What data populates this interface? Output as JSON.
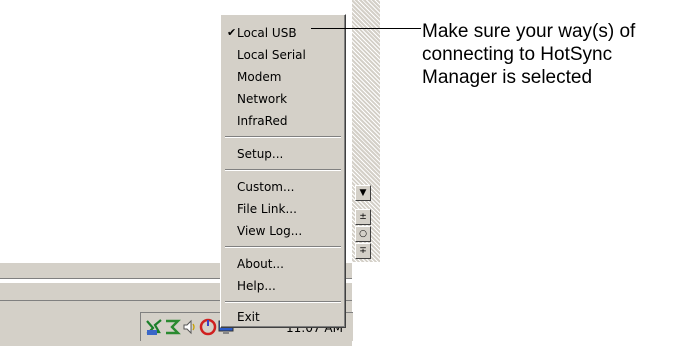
{
  "menu": {
    "items": [
      {
        "label": "Local USB",
        "checked": true
      },
      {
        "label": "Local Serial",
        "checked": false
      },
      {
        "label": "Modem",
        "checked": false
      },
      {
        "label": "Network",
        "checked": false
      },
      {
        "label": "InfraRed",
        "checked": false
      },
      {
        "label": "Setup...",
        "checked": false
      },
      {
        "label": "Custom...",
        "checked": false
      },
      {
        "label": "File Link...",
        "checked": false
      },
      {
        "label": "View Log...",
        "checked": false
      },
      {
        "label": "About...",
        "checked": false
      },
      {
        "label": "Help...",
        "checked": false
      },
      {
        "label": "Exit",
        "checked": false
      }
    ],
    "check_glyph": "✔"
  },
  "callout": {
    "lines": [
      "Make sure your way(s) of",
      "connecting to HotSync",
      "Manager is selected"
    ]
  },
  "tray": {
    "clock": "11:07 AM",
    "icons": [
      "hotsync-icon",
      "network-icon",
      "volume-icon",
      "app-icon",
      "monitor-icon"
    ]
  },
  "scrollbar": {
    "glyphs": [
      "▼",
      "±",
      "○",
      "∓"
    ]
  }
}
